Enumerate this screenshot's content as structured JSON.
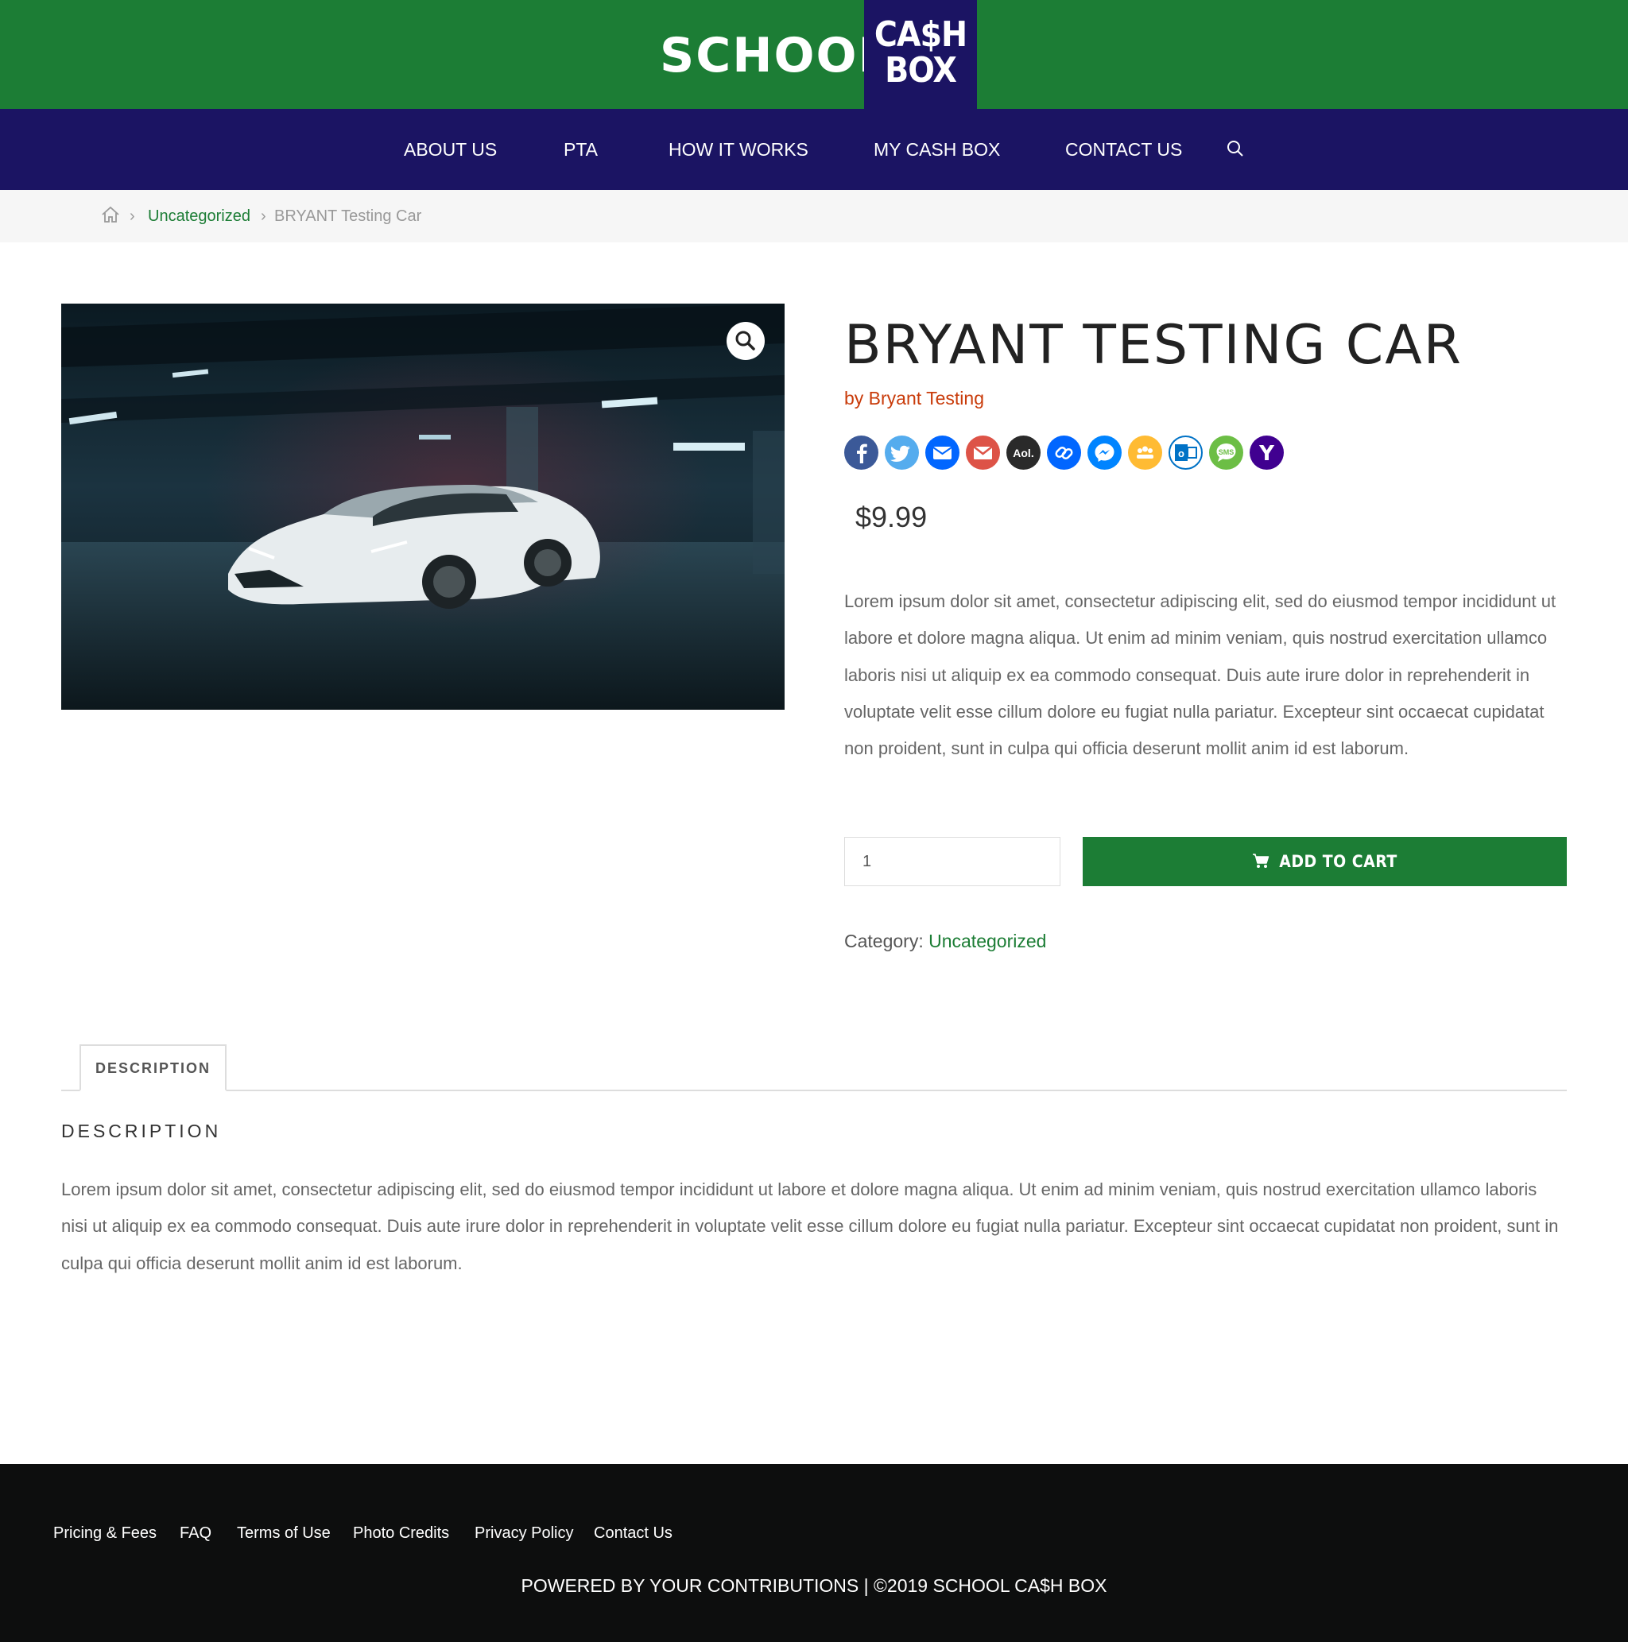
{
  "header": {
    "logo_left": "SCHOOL",
    "logo_right_line1": "CA$H",
    "logo_right_line2": "BOX",
    "brand_green": "#1c7d35",
    "brand_navy": "#1b1463"
  },
  "nav": {
    "items": [
      "ABOUT US",
      "PTA",
      "HOW IT WORKS",
      "MY CASH BOX",
      "CONTACT US"
    ],
    "search_icon": "search-icon"
  },
  "breadcrumb": {
    "home_icon": "home-icon",
    "category": "Uncategorized",
    "current": "BRYANT Testing Car"
  },
  "product": {
    "image_alt": "white sports car in a dark parking garage",
    "title": "BRYANT TESTING CAR",
    "by": "by Bryant Testing",
    "share_buttons": [
      "facebook",
      "twitter",
      "email",
      "gmail",
      "aol",
      "copy-link",
      "messenger",
      "myspace",
      "outlook",
      "sms",
      "yahoo"
    ],
    "price": "$9.99",
    "description": "Lorem ipsum dolor sit amet, consectetur adipiscing elit, sed do eiusmod tempor incididunt ut labore et dolore magna aliqua. Ut enim ad minim veniam, quis nostrud exercitation ullamco laboris nisi ut aliquip ex ea commodo consequat. Duis aute irure dolor in reprehenderit in voluptate velit esse cillum dolore eu fugiat nulla pariatur. Excepteur sint occaecat cupidatat non proident, sunt in culpa qui officia deserunt mollit anim id est laborum.",
    "quantity": "1",
    "add_to_cart": "ADD TO CART",
    "category_label": "Category:",
    "category_value": "Uncategorized"
  },
  "tabs": {
    "tab_label": "DESCRIPTION",
    "heading": "DESCRIPTION",
    "body": "Lorem ipsum dolor sit amet, consectetur adipiscing elit, sed do eiusmod tempor incididunt ut labore et dolore magna aliqua. Ut enim ad minim veniam, quis nostrud exercitation ullamco laboris nisi ut aliquip ex ea commodo consequat. Duis aute irure dolor in reprehenderit in voluptate velit esse cillum dolore eu fugiat nulla pariatur. Excepteur sint occaecat cupidatat non proident, sunt in culpa qui officia deserunt mollit anim id est laborum."
  },
  "footer": {
    "links": [
      "Pricing & Fees",
      "FAQ",
      "Terms of Use",
      "Photo Credits",
      "Privacy Policy",
      "Contact Us"
    ],
    "copyright": "POWERED BY YOUR CONTRIBUTIONS | ©2019 SCHOOL CA$H BOX"
  }
}
